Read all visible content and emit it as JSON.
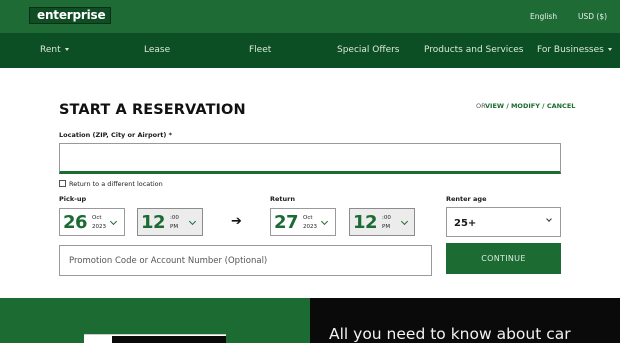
{
  "header": {
    "logo_text": "enterprise",
    "language": "English",
    "currency": "USD ($)"
  },
  "nav": {
    "items": [
      {
        "label": "Rent",
        "dropdown": true
      },
      {
        "label": "Lease",
        "dropdown": false
      },
      {
        "label": "Fleet",
        "dropdown": false
      },
      {
        "label": "Special Offers",
        "dropdown": false
      },
      {
        "label": "Products and Services",
        "dropdown": false
      },
      {
        "label": "For Businesses",
        "dropdown": true
      }
    ]
  },
  "reservation": {
    "title": "START A RESERVATION",
    "or_label": "OR",
    "view_modify_cancel": "VIEW / MODIFY / CANCEL",
    "location_label": "Location (ZIP, City or Airport) *",
    "location_value": "",
    "return_different_label": "Return to a different location",
    "pickup": {
      "label": "Pick-up",
      "day": "26",
      "month": "Oct",
      "year": "2023",
      "hour": "12",
      "minute": ":00",
      "ampm": "PM"
    },
    "return": {
      "label": "Return",
      "day": "27",
      "month": "Oct",
      "year": "2023",
      "hour": "12",
      "minute": ":00",
      "ampm": "PM"
    },
    "renter_age_label": "Renter age",
    "renter_age_value": "25+",
    "promo_placeholder": "Promotion Code or Account Number (Optional)",
    "continue_label": "CONTINUE"
  },
  "footer": {
    "right_text": "All you need to know about car"
  },
  "colors": {
    "brand_green": "#1b6b33",
    "nav_green": "#0d4f24",
    "topbar_green": "#1f6b36"
  }
}
